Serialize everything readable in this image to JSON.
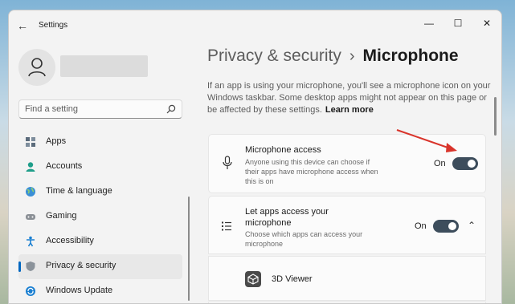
{
  "window": {
    "title": "Settings",
    "back_icon": "back-arrow-icon",
    "controls": {
      "minimize": "—",
      "maximize": "☐",
      "close": "✕"
    }
  },
  "user": {
    "name": ""
  },
  "search": {
    "placeholder": "Find a setting",
    "icon": "search-icon"
  },
  "sidebar": {
    "items": [
      {
        "label": "Apps",
        "icon": "apps-icon",
        "active": false
      },
      {
        "label": "Accounts",
        "icon": "accounts-icon",
        "active": false
      },
      {
        "label": "Time & language",
        "icon": "globe-icon",
        "active": false
      },
      {
        "label": "Gaming",
        "icon": "gamepad-icon",
        "active": false
      },
      {
        "label": "Accessibility",
        "icon": "accessibility-icon",
        "active": false
      },
      {
        "label": "Privacy & security",
        "icon": "shield-icon",
        "active": true
      },
      {
        "label": "Windows Update",
        "icon": "update-icon",
        "active": false
      }
    ]
  },
  "breadcrumb": {
    "parent": "Privacy & security",
    "separator": "›",
    "current": "Microphone"
  },
  "description": {
    "text": "If an app is using your microphone, you'll see a microphone icon on your Windows taskbar. Some desktop apps might not appear on this page or be affected by these settings.",
    "link": "Learn more"
  },
  "microphone_access": {
    "title": "Microphone access",
    "subtitle": "Anyone using this device can choose if their apps have microphone access when this is on",
    "state_label": "On",
    "enabled": true,
    "icon": "microphone-icon"
  },
  "app_access": {
    "title": "Let apps access your microphone",
    "subtitle": "Choose which apps can access your microphone",
    "state_label": "On",
    "enabled": true,
    "expand_icon": "chevron-up-icon",
    "icon": "app-list-icon"
  },
  "apps": [
    {
      "name": "3D Viewer",
      "icon": "3d-viewer-icon"
    }
  ],
  "colors": {
    "accent": "#0067c0",
    "toggle_on": "#3d4d5c",
    "annotation_arrow": "#d9342b"
  }
}
